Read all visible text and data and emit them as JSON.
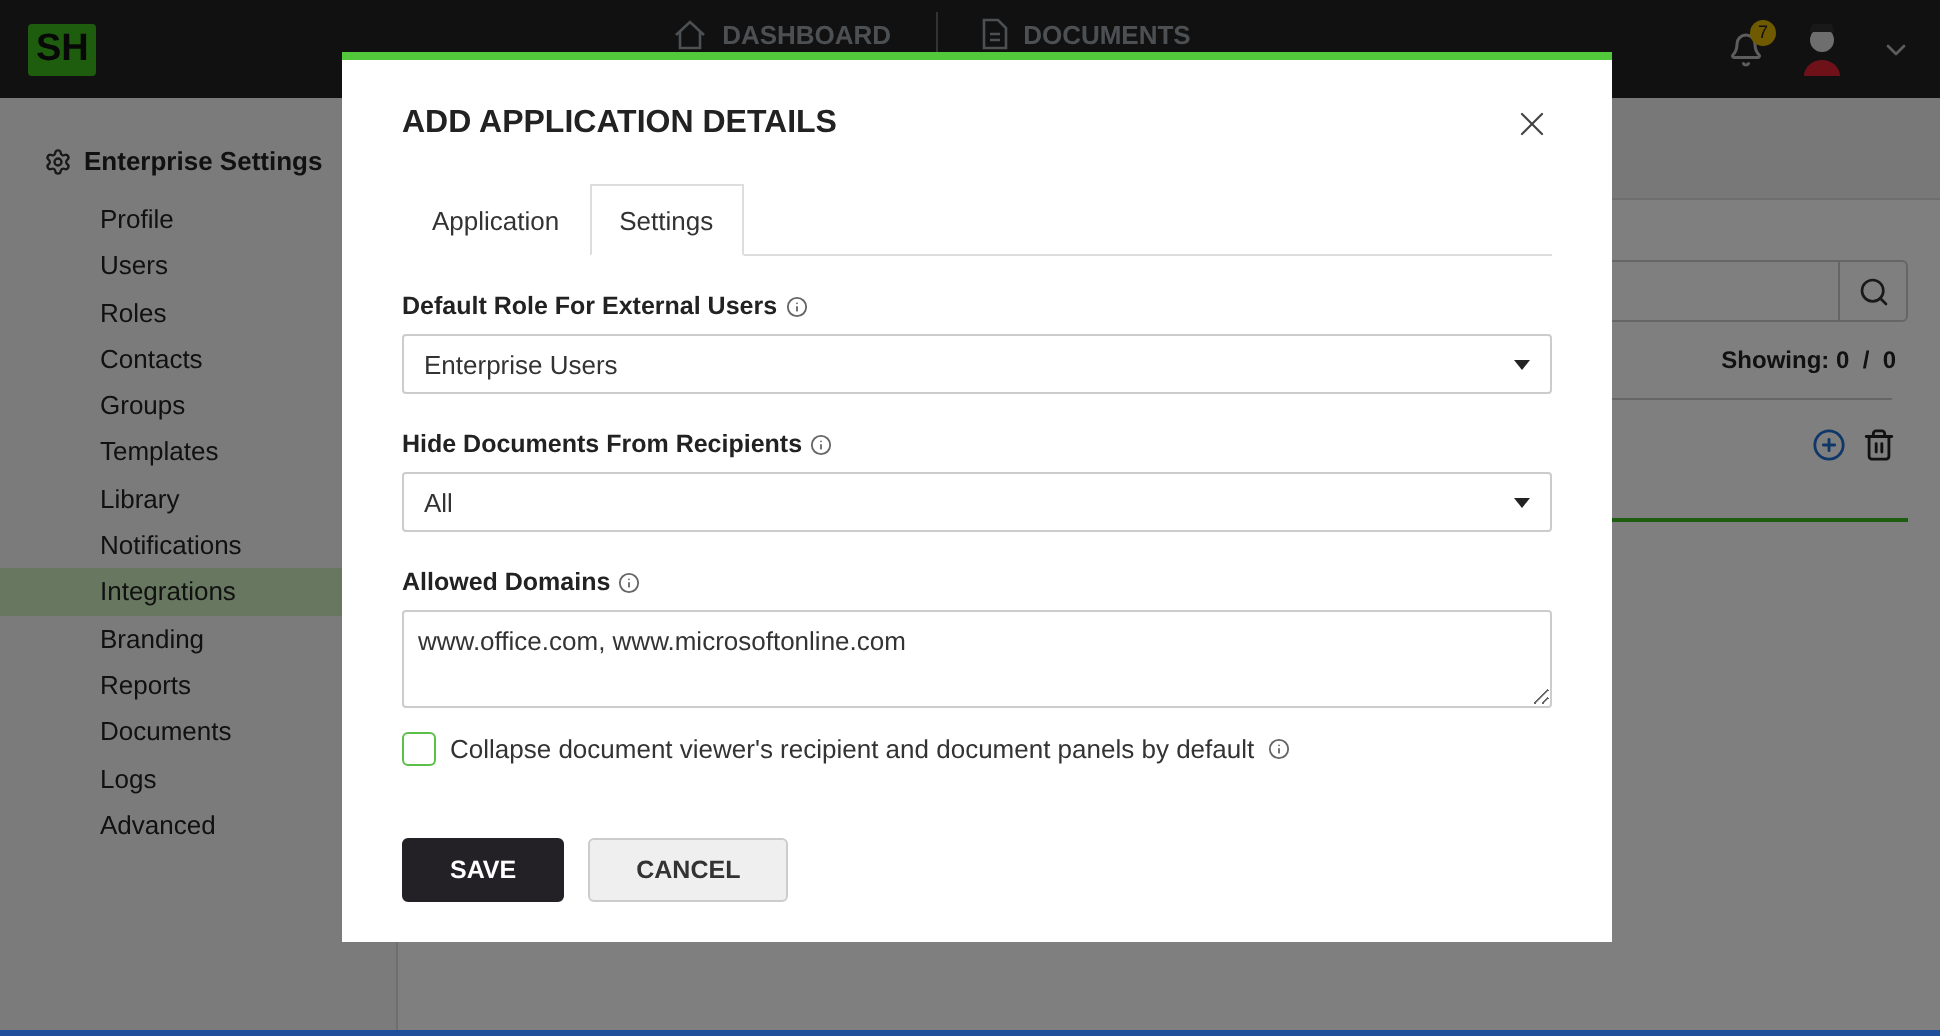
{
  "topbar": {
    "logo": "SH",
    "nav": [
      {
        "label": "DASHBOARD",
        "kind": "home"
      },
      {
        "label": "DOCUMENTS",
        "kind": "document"
      }
    ],
    "notifications": "7"
  },
  "sidebar": {
    "title": "Enterprise Settings",
    "items": [
      {
        "label": "Profile",
        "selected": false
      },
      {
        "label": "Users",
        "selected": false
      },
      {
        "label": "Roles",
        "selected": false
      },
      {
        "label": "Contacts",
        "selected": false
      },
      {
        "label": "Groups",
        "selected": false
      },
      {
        "label": "Templates",
        "selected": false
      },
      {
        "label": "Library",
        "selected": false
      },
      {
        "label": "Notifications",
        "selected": false
      },
      {
        "label": "Integrations",
        "selected": true
      },
      {
        "label": "Branding",
        "selected": false
      },
      {
        "label": "Reports",
        "selected": false
      },
      {
        "label": "Documents",
        "selected": false
      },
      {
        "label": "Logs",
        "selected": false
      },
      {
        "label": "Advanced",
        "selected": false
      }
    ]
  },
  "content": {
    "showing": "Showing: 0  /  0"
  },
  "dialog": {
    "title": "ADD APPLICATION DETAILS",
    "tabs": [
      {
        "label": "Application",
        "selected": false
      },
      {
        "label": "Settings",
        "selected": true
      }
    ],
    "fields": [
      {
        "kind": "select",
        "label": "Default Role For External Users",
        "value": "Enterprise Users"
      },
      {
        "kind": "select",
        "label": "Hide Documents From Recipients",
        "value": "All"
      },
      {
        "kind": "textarea",
        "label": "Allowed Domains",
        "value": "www.office.com, www.microsoftonline.com"
      }
    ],
    "checkbox": {
      "label": "Collapse document viewer's recipient and document panels by default",
      "checked": false
    },
    "buttons": [
      {
        "label": "SAVE",
        "kind": "primary"
      },
      {
        "label": "CANCEL",
        "kind": "secondary"
      }
    ]
  }
}
